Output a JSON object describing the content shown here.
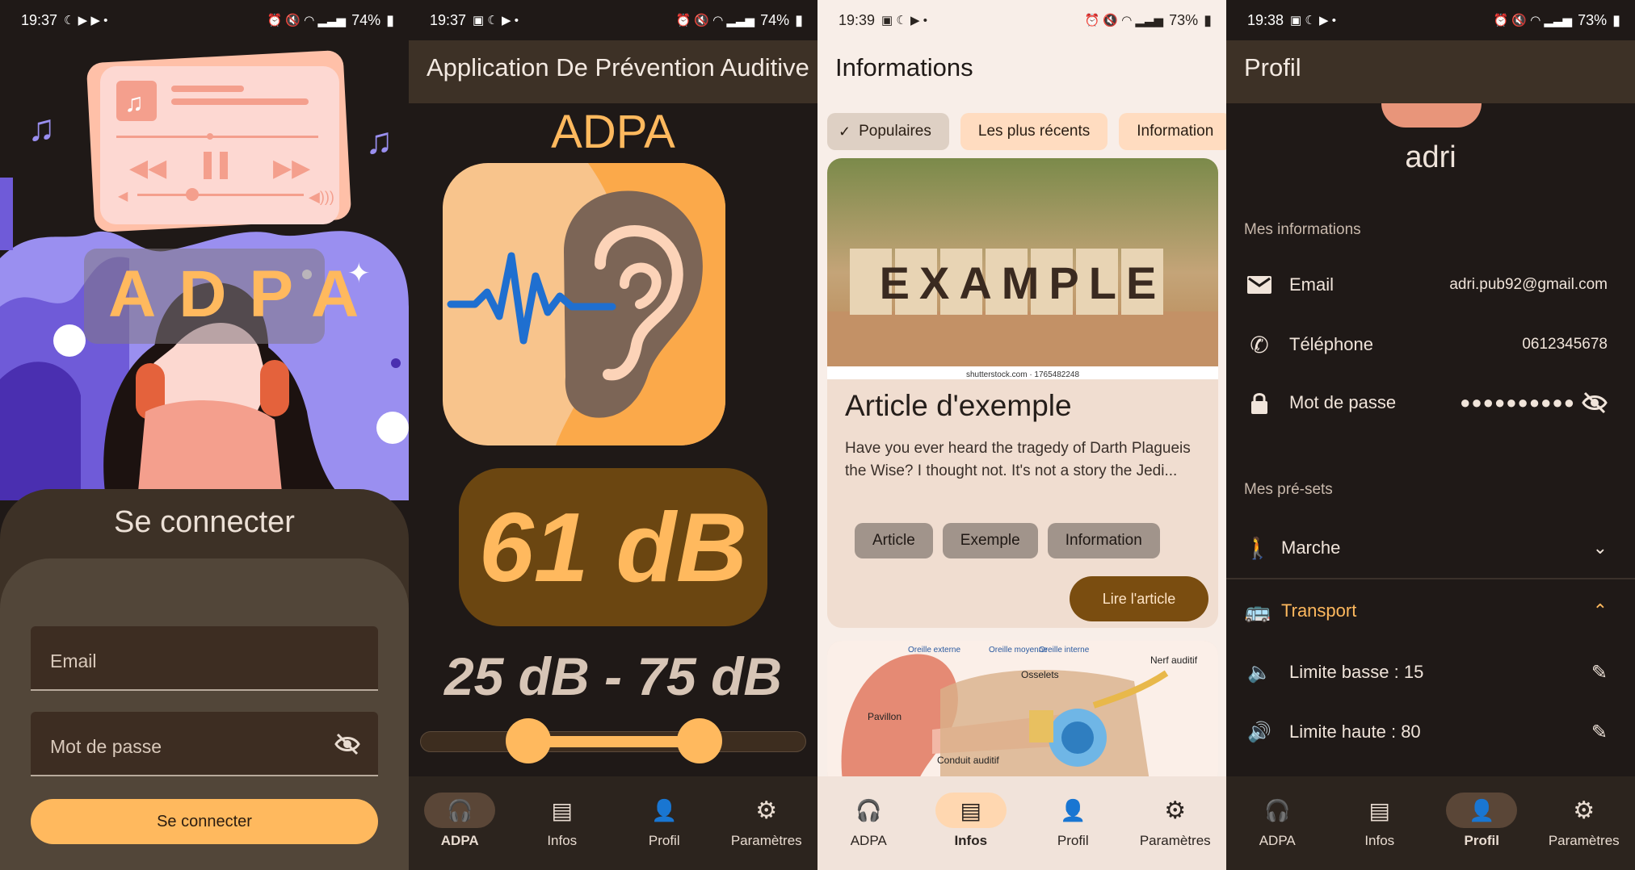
{
  "status_bars": [
    {
      "time": "19:37",
      "battery": "74%"
    },
    {
      "time": "19:37",
      "battery": "74%"
    },
    {
      "time": "19:39",
      "battery": "73%"
    },
    {
      "time": "19:38",
      "battery": "73%"
    }
  ],
  "login": {
    "logo": "ADPA",
    "title": "Se connecter",
    "email_label": "Email",
    "password_label": "Mot de passe",
    "button": "Se connecter"
  },
  "home": {
    "appbar_title": "Application De Prévention Auditive",
    "brand": "ADPA",
    "level": "61 dB",
    "range_text": "25 dB - 75 dB",
    "range_low": 25,
    "range_high": 75,
    "accent": "#ffb95e"
  },
  "infos": {
    "appbar_title": "Informations",
    "chips": [
      "Populaires",
      "Les plus récents",
      "Information"
    ],
    "selected_chip": "Populaires",
    "article": {
      "image_word": "EXAMPLE",
      "image_credit": "shutterstock.com · 1765482248",
      "title": "Article d'exemple",
      "text": "Have you ever heard the tragedy of Darth Plagueis the Wise? I thought not. It's not a story the Jedi...",
      "tags": [
        "Article",
        "Exemple",
        "Information"
      ],
      "read_button": "Lire l'article"
    },
    "diagram_labels": [
      "Oreille externe",
      "Oreille moyenne",
      "Oreille interne",
      "Nerf auditif",
      "Osselets",
      "Pavillon",
      "Conduit auditif"
    ]
  },
  "profile": {
    "appbar_title": "Profil",
    "username": "adri",
    "info_section": "Mes informations",
    "email_label": "Email",
    "email_value": "adri.pub92@gmail.com",
    "phone_label": "Téléphone",
    "phone_value": "0612345678",
    "password_label": "Mot de passe",
    "password_value": "●●●●●●●●●●",
    "presets_section": "Mes pré-sets",
    "presets": [
      {
        "label": "Marche",
        "expanded": false
      },
      {
        "label": "Transport",
        "expanded": true
      }
    ],
    "low_limit": "Limite basse : 15",
    "high_limit": "Limite haute : 80"
  },
  "nav": {
    "items": [
      "ADPA",
      "Infos",
      "Profil",
      "Paramètres"
    ],
    "active_per_screen": [
      "ADPA",
      "Infos",
      "Profil"
    ]
  }
}
